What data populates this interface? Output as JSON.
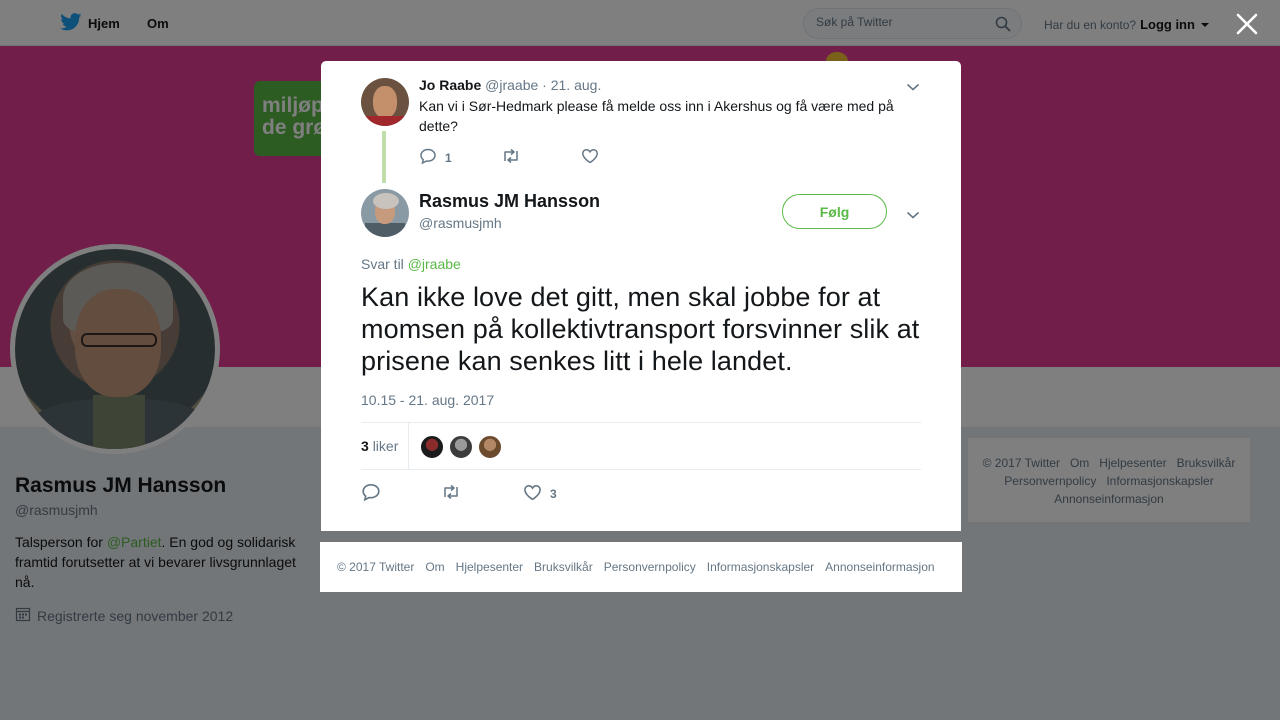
{
  "nav": {
    "home_label": "Hjem",
    "about_label": "Om",
    "search_placeholder": "Søk på Twitter",
    "account_prompt": "Har du en konto?",
    "login_label": "Logg inn"
  },
  "banner": {
    "logo_line1": "miljøp",
    "logo_line2": "de grø"
  },
  "profile": {
    "name": "Rasmus JM Hansson",
    "handle": "@rasmusjmh",
    "bio_prefix": "Talsperson for ",
    "bio_mention": "@Partiet",
    "bio_suffix": ". En god og solidarisk framtid forutsetter at vi bevarer livsgrunnlaget nå.",
    "joined": "Registrerte seg november 2012"
  },
  "side_footer": {
    "links": [
      "© 2017 Twitter",
      "Om",
      "Hjelpesenter",
      "Bruksvilkår",
      "Personvernpolicy",
      "Informasjonskapsler",
      "Annonseinformasjon"
    ]
  },
  "parent_tweet": {
    "name": "Jo Raabe",
    "handle": "@jraabe",
    "separator": "·",
    "date": "21. aug.",
    "text": "Kan vi i Sør-Hedmark please få melde oss inn i Akershus og få være med på dette?",
    "reply_count": "1"
  },
  "main_tweet": {
    "name": "Rasmus JM Hansson",
    "handle": "@rasmusjmh",
    "follow_label": "Følg",
    "reply_prefix": "Svar til ",
    "reply_mention": "@jraabe",
    "text": "Kan ikke love det gitt, men skal jobbe for at momsen på kollektivtransport forsvinner slik at prisene kan senkes litt i hele landet.",
    "timestamp": "10.15 - 21. aug. 2017",
    "likes_count": "3",
    "likes_label": "liker",
    "like_action_count": "3"
  },
  "modal_footer": {
    "links": [
      "© 2017 Twitter",
      "Om",
      "Hjelpesenter",
      "Bruksvilkår",
      "Personvernpolicy",
      "Informasjonskapsler",
      "Annonseinformasjon"
    ]
  },
  "colors": {
    "banner": "#e33c96",
    "accent": "#5ab947",
    "text_primary": "#14171a",
    "text_secondary": "#657786",
    "twitter_blue": "#1da1f2"
  }
}
